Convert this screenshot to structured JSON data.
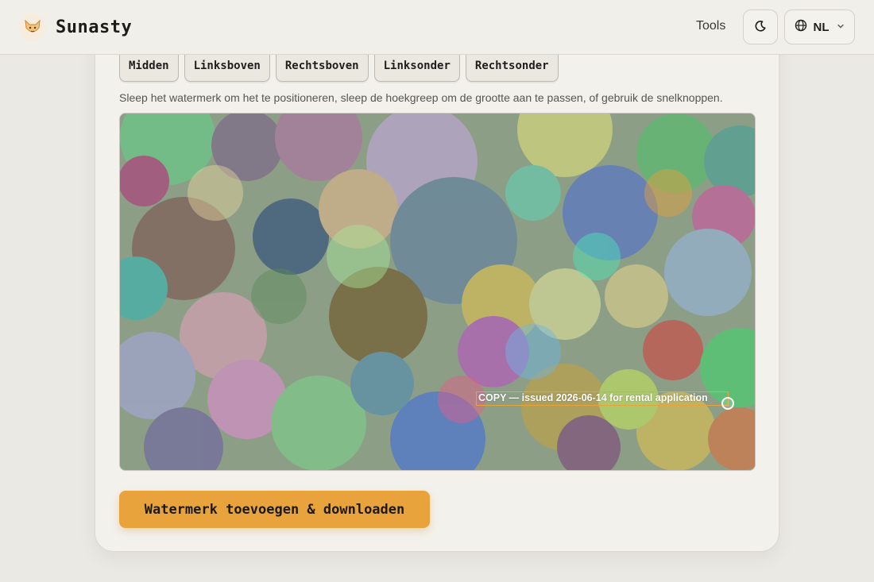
{
  "header": {
    "brand_name": "Sunasty",
    "logo_icon": "fox-logo-icon",
    "nav_tools": "Tools",
    "theme_icon": "moon-icon",
    "language": "NL",
    "language_icon": "globe-icon",
    "language_chevron": "chevron-down-icon"
  },
  "positions": [
    {
      "label": "Midden"
    },
    {
      "label": "Linksboven"
    },
    {
      "label": "Rechtsboven"
    },
    {
      "label": "Linksonder"
    },
    {
      "label": "Rechtsonder"
    }
  ],
  "hint": "Sleep het watermerk om het te positioneren, sleep de hoekgreep om de grootte aan te passen, of gebruik de snelknoppen.",
  "watermark": {
    "text": "COPY — issued 2026-06-14 for rental application",
    "border_color": "#e8a33c"
  },
  "download_button": "Watermerk toevoegen & downloaden",
  "colors": {
    "accent": "#e9a33c",
    "background": "#ebe9e4",
    "card": "#f3f1ec"
  }
}
